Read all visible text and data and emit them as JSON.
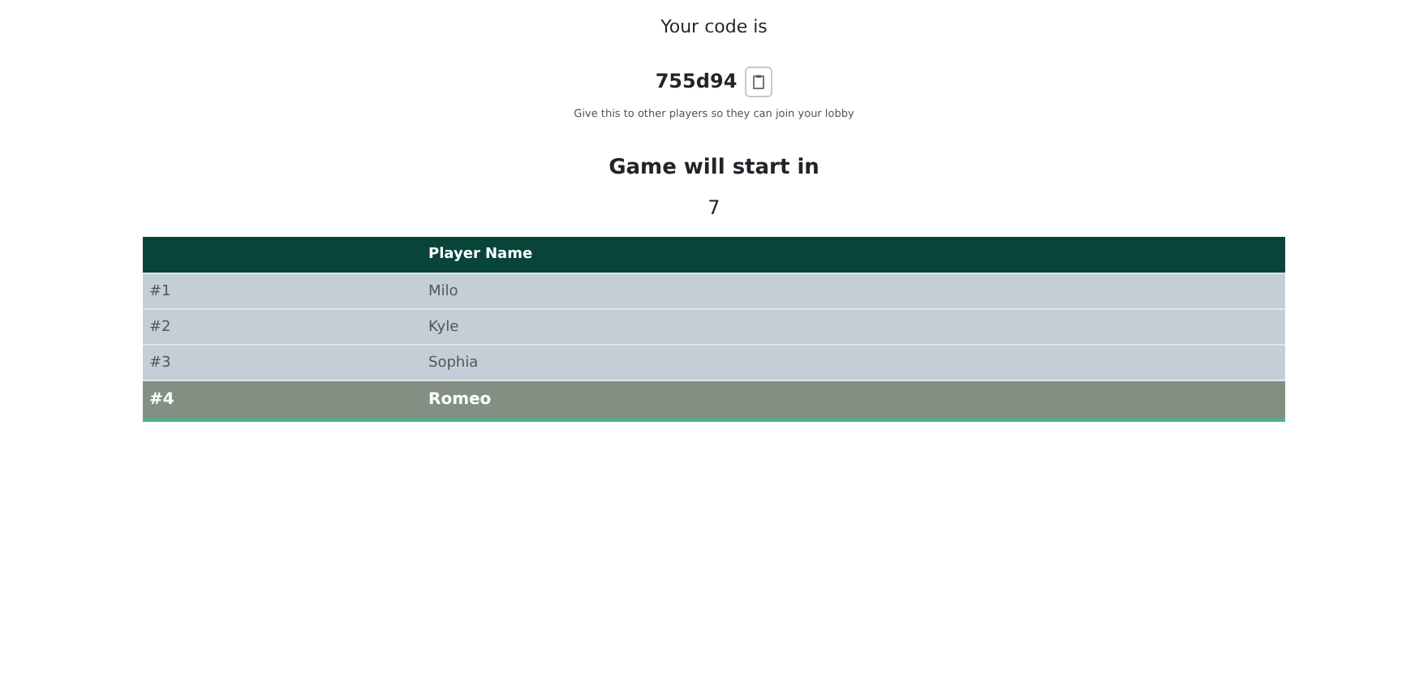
{
  "title": "Your code is",
  "code": "755d94",
  "hint": "Give this to other players so they can join your lobby",
  "countdown": {
    "heading": "Game will start in",
    "value": "7"
  },
  "table": {
    "columns": [
      "Player Name"
    ],
    "rows": [
      {
        "rank": "#1",
        "name": "Milo",
        "selected": false
      },
      {
        "rank": "#2",
        "name": "Kyle",
        "selected": false
      },
      {
        "rank": "#3",
        "name": "Sophia",
        "selected": false
      },
      {
        "rank": "#4",
        "name": "Romeo",
        "selected": true
      }
    ]
  }
}
